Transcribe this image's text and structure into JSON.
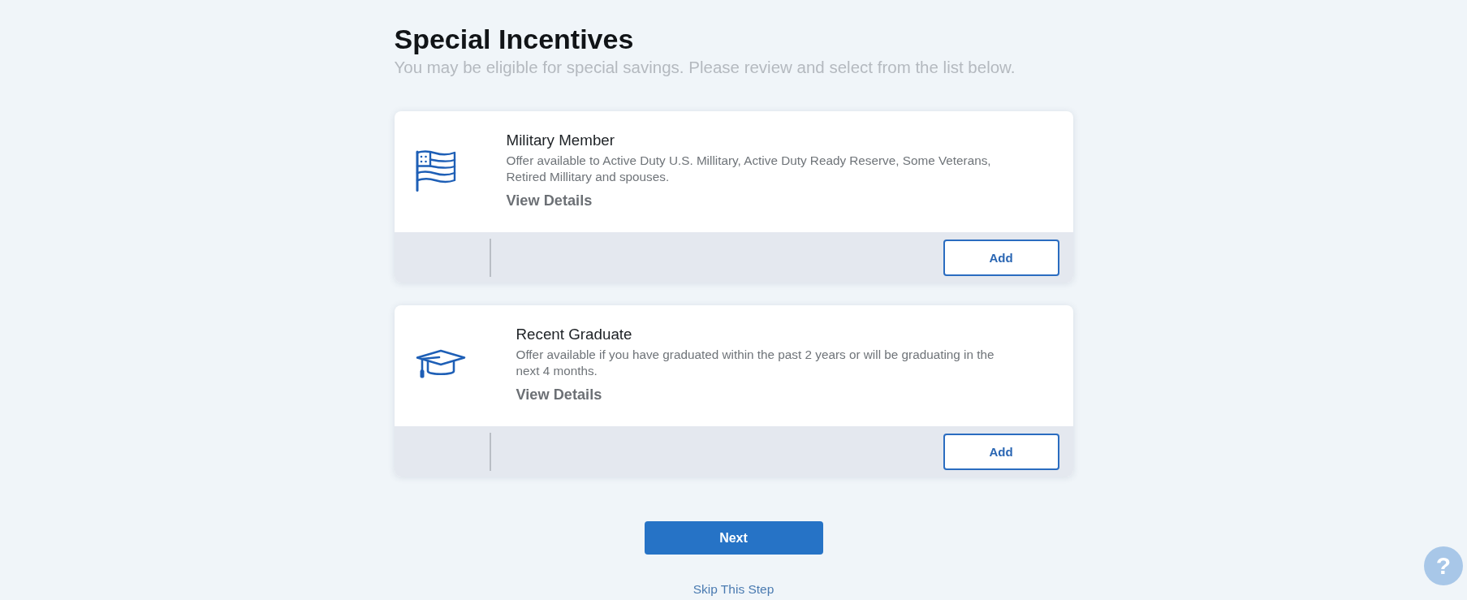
{
  "header": {
    "title": "Special Incentives",
    "subtitle": "You may be eligible for special savings. Please review and select from the list below."
  },
  "incentives": [
    {
      "kind": "flag",
      "title": "Military Member",
      "description": "Offer available to Active Duty U.S. Millitary, Active Duty Ready Reserve, Some Veterans, Retired Millitary and spouses.",
      "details_link": "View Details",
      "add_button": "Add"
    },
    {
      "kind": "graduation-cap",
      "title": "Recent Graduate",
      "description": "Offer available if you have graduated within the past 2 years or will be graduating in the next 4 months.",
      "details_link": "View Details",
      "add_button": "Add"
    }
  ],
  "actions": {
    "next_button": "Next",
    "skip_link": "Skip This Step"
  },
  "help_button": "?"
}
